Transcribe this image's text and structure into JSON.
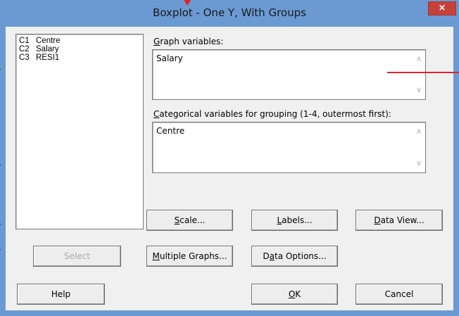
{
  "window": {
    "title": "Boxplot - One Y, With Groups",
    "close_glyph": "×"
  },
  "variable_list": {
    "items": [
      {
        "col": "C1",
        "name": "Centre"
      },
      {
        "col": "C2",
        "name": "Salary"
      },
      {
        "col": "C3",
        "name": "RESI1"
      }
    ]
  },
  "graph_variables": {
    "label_u": "G",
    "label_rest": "raph variables:",
    "value": "Salary"
  },
  "categorical_variables": {
    "label_u": "C",
    "label_rest": "ategorical variables for grouping (1-4, outermost first):",
    "value": "Centre"
  },
  "buttons": {
    "scale": {
      "u": "S",
      "rest": "cale..."
    },
    "labels": {
      "u": "L",
      "rest": "abels..."
    },
    "data_view": {
      "u": "D",
      "rest": "ata View..."
    },
    "select": "Select",
    "multiple_graphs": {
      "u": "M",
      "rest": "ultiple Graphs..."
    },
    "data_options": {
      "pre": "D",
      "u": "a",
      "rest": "ta Options..."
    },
    "help": "Help",
    "ok": {
      "u": "O",
      "rest": "K"
    },
    "cancel": "Cancel"
  },
  "icons": {
    "scroll_up": "∧",
    "scroll_down": "∨"
  },
  "colors": {
    "title_bar": "#6b9ad2",
    "close_button": "#c7413b",
    "annotation_red": "#e0222e"
  }
}
